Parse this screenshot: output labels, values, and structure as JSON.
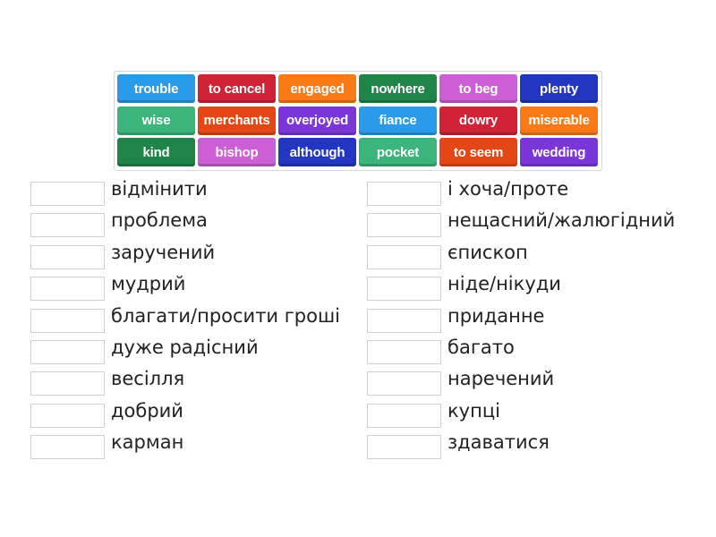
{
  "tiles": [
    {
      "label": "trouble",
      "color": "#2a9be8"
    },
    {
      "label": "to cancel",
      "color": "#d12338"
    },
    {
      "label": "engaged",
      "color": "#fb7a18"
    },
    {
      "label": "nowhere",
      "color": "#1f8448"
    },
    {
      "label": "to beg",
      "color": "#cc5fd6"
    },
    {
      "label": "plenty",
      "color": "#2236c2"
    },
    {
      "label": "wise",
      "color": "#3bb57c"
    },
    {
      "label": "merchants",
      "color": "#e34716"
    },
    {
      "label": "overjoyed",
      "color": "#7a36d8"
    },
    {
      "label": "fiance",
      "color": "#2a9be8"
    },
    {
      "label": "dowry",
      "color": "#d12338"
    },
    {
      "label": "miserable",
      "color": "#fb7a18"
    },
    {
      "label": "kind",
      "color": "#1f8448"
    },
    {
      "label": "bishop",
      "color": "#cc5fd6"
    },
    {
      "label": "although",
      "color": "#2236c2"
    },
    {
      "label": "pocket",
      "color": "#3bb57c"
    },
    {
      "label": "to seem",
      "color": "#e34716"
    },
    {
      "label": "wedding",
      "color": "#7a36d8"
    }
  ],
  "left": [
    "відмінити",
    "проблема",
    "заручений",
    "мудрий",
    "благати/просити гроші",
    "дуже радісний",
    "весілля",
    "добрий",
    "карман"
  ],
  "right": [
    "і хоча/проте",
    "нещасний/жалюгідний",
    "єпископ",
    "ніде/нікуди",
    "приданне",
    "багато",
    "наречений",
    "купці",
    "здаватися"
  ]
}
